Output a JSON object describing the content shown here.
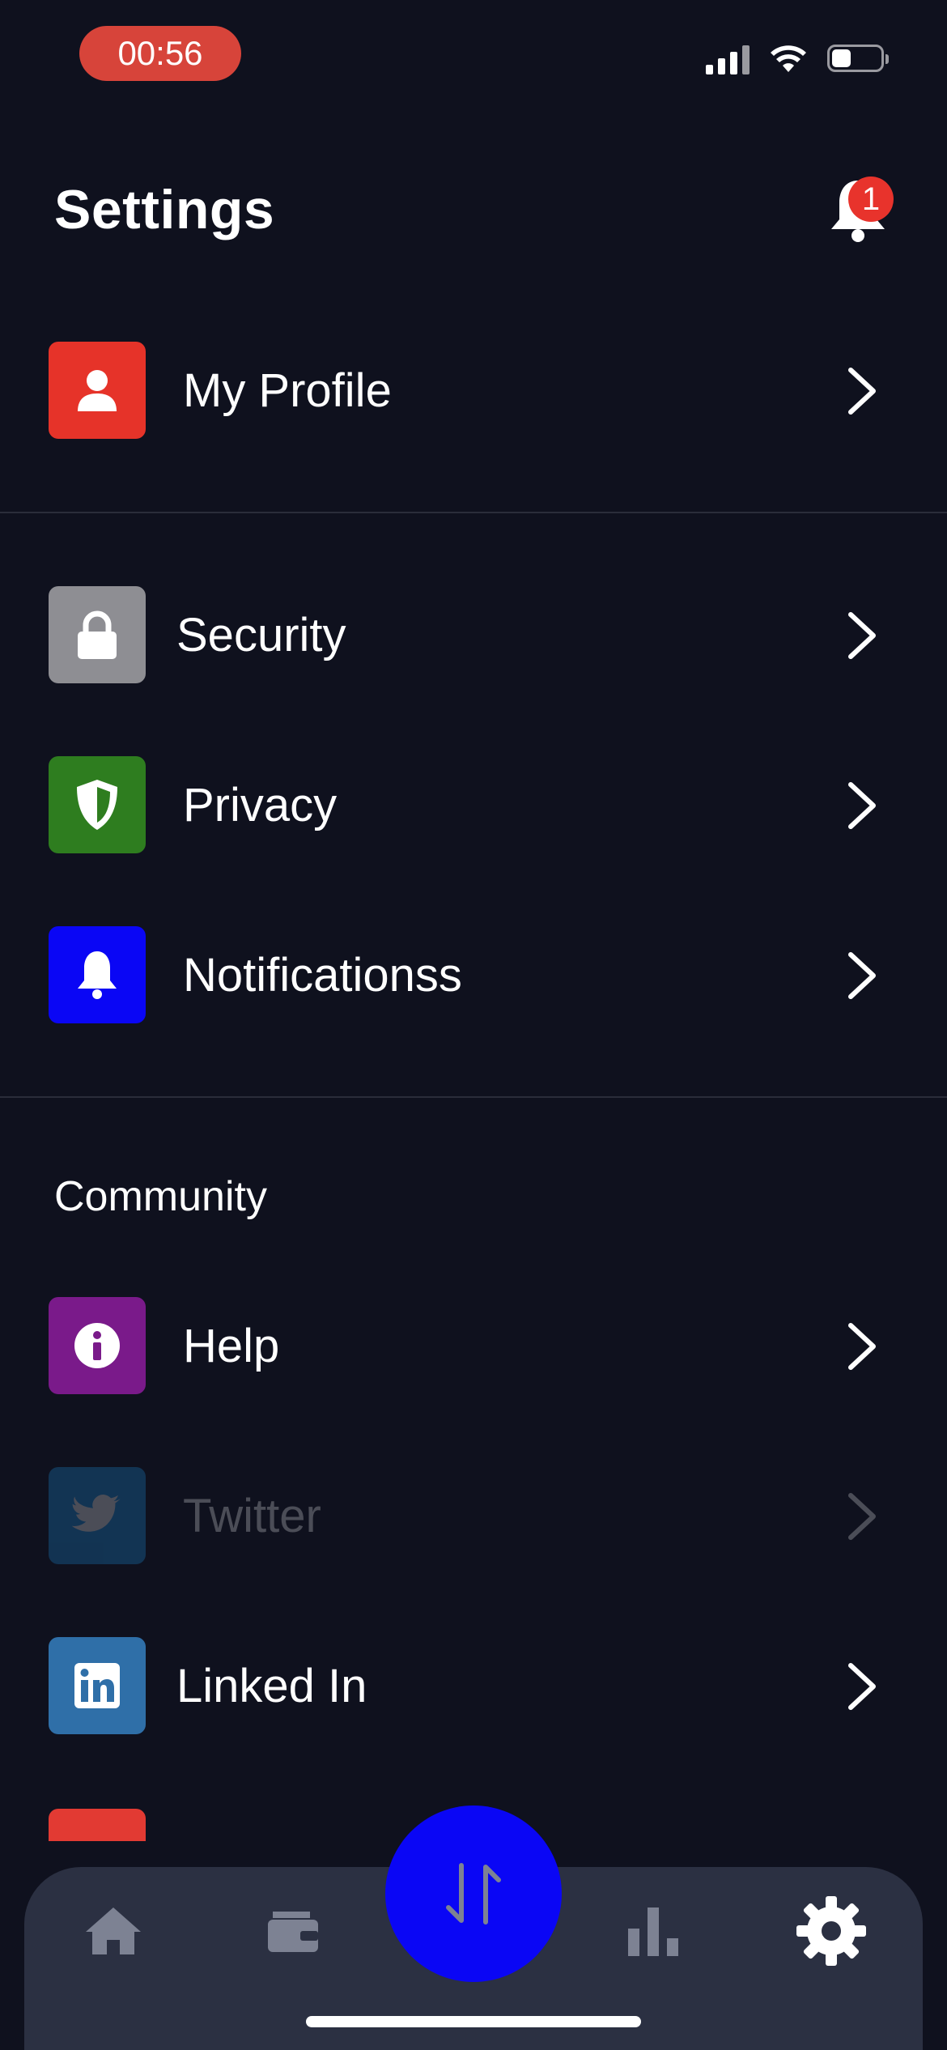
{
  "status_bar": {
    "time": "00:56",
    "battery_level": 0.4
  },
  "header": {
    "title": "Settings",
    "notification_count": "1"
  },
  "profile": {
    "label": "My Profile",
    "icon": "person-icon",
    "color": "#e63329"
  },
  "general_items": [
    {
      "label": "Security",
      "icon": "lock-icon",
      "color": "#8e8e93"
    },
    {
      "label": "Privacy",
      "icon": "shield-icon",
      "color": "#2e7d1f"
    },
    {
      "label": "Notificationss",
      "icon": "bell-icon",
      "color": "#0a06f5"
    }
  ],
  "community": {
    "title": "Community",
    "items": [
      {
        "label": "Help",
        "icon": "info-icon",
        "color": "#7a1a8a"
      },
      {
        "label": "Twitter",
        "icon": "twitter-icon",
        "color": "#1d9bf0",
        "dimmed": true
      },
      {
        "label": "Linked In",
        "icon": "linkedin-icon",
        "color": "#2f6fa8"
      }
    ]
  },
  "tab_bar": {
    "tabs": [
      "home-icon",
      "wallet-icon",
      "swap-icon",
      "bar-chart-icon",
      "gear-icon"
    ],
    "active": "gear-icon"
  }
}
